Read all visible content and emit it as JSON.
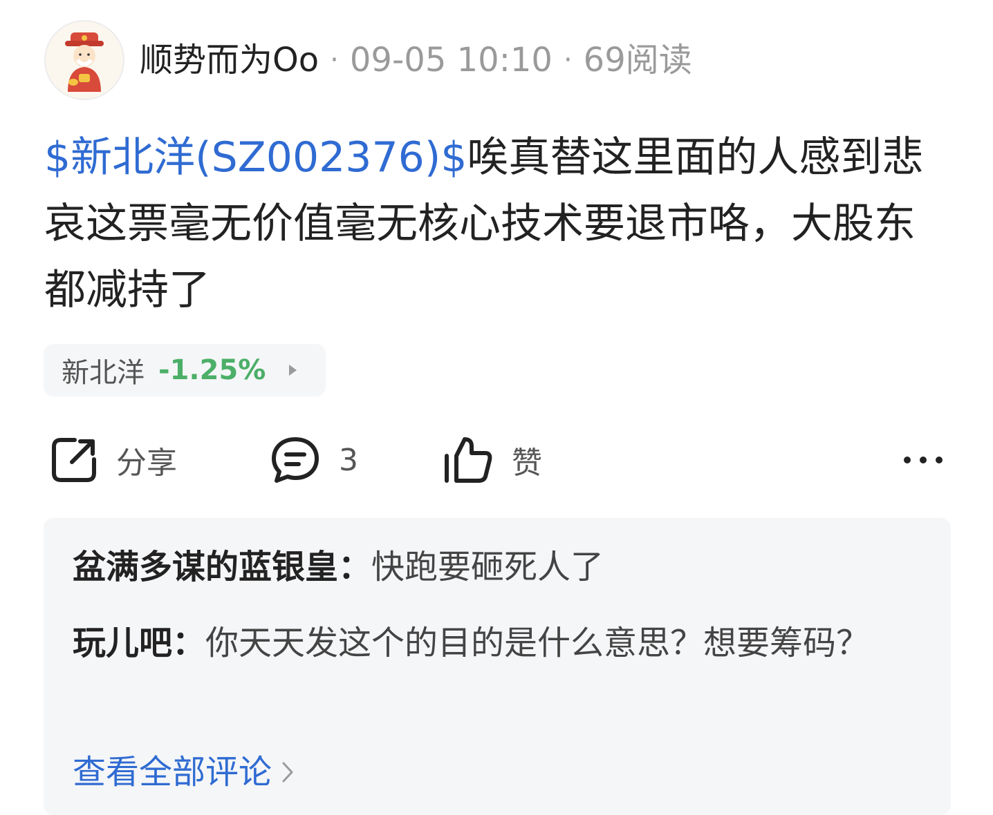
{
  "post": {
    "author": "顺势而为Oo",
    "time": "09-05 10:10",
    "reads": "69阅读",
    "stock_tag": "$新北洋(SZ002376)$",
    "text": "唉真替这里面的人感到悲哀这票毫无价值毫无核心技术要退市咯，大股东都减持了",
    "separator": "·"
  },
  "stock_chip": {
    "name": "新北洋",
    "change": "-1.25%",
    "change_color": "#4caf68"
  },
  "actions": {
    "share_label": "分享",
    "comment_count": "3",
    "like_label": "赞"
  },
  "comments": {
    "items": [
      {
        "author": "盆满多谋的蓝银皇：",
        "text": "快跑要砸死人了"
      },
      {
        "author": "玩儿吧：",
        "text": "你天天发这个的目的是什么意思？想要筹码？"
      }
    ],
    "view_all_label": "查看全部评论"
  },
  "colors": {
    "link": "#2f6bd2",
    "muted": "#9a9a9a",
    "panel_bg": "#f5f6f8"
  },
  "icons": {
    "share": "share-icon",
    "comment": "comment-icon",
    "like": "thumbs-up-icon",
    "more": "more-dots-icon",
    "chevron": "chevron-right-icon"
  }
}
